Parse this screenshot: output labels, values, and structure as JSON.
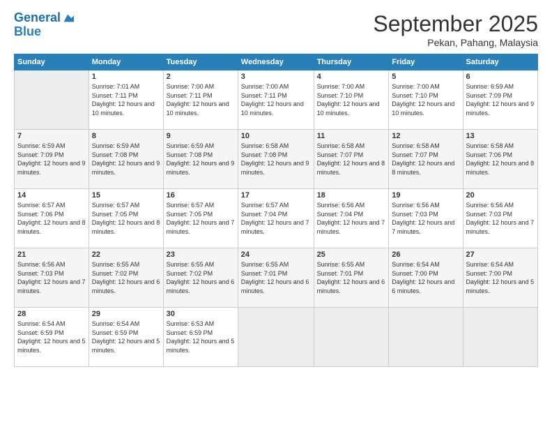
{
  "header": {
    "logo_line1": "General",
    "logo_line2": "Blue",
    "month_title": "September 2025",
    "subtitle": "Pekan, Pahang, Malaysia"
  },
  "columns": [
    "Sunday",
    "Monday",
    "Tuesday",
    "Wednesday",
    "Thursday",
    "Friday",
    "Saturday"
  ],
  "weeks": [
    [
      {
        "day": "",
        "sunrise": "",
        "sunset": "",
        "daylight": ""
      },
      {
        "day": "1",
        "sunrise": "Sunrise: 7:01 AM",
        "sunset": "Sunset: 7:11 PM",
        "daylight": "Daylight: 12 hours and 10 minutes."
      },
      {
        "day": "2",
        "sunrise": "Sunrise: 7:00 AM",
        "sunset": "Sunset: 7:11 PM",
        "daylight": "Daylight: 12 hours and 10 minutes."
      },
      {
        "day": "3",
        "sunrise": "Sunrise: 7:00 AM",
        "sunset": "Sunset: 7:11 PM",
        "daylight": "Daylight: 12 hours and 10 minutes."
      },
      {
        "day": "4",
        "sunrise": "Sunrise: 7:00 AM",
        "sunset": "Sunset: 7:10 PM",
        "daylight": "Daylight: 12 hours and 10 minutes."
      },
      {
        "day": "5",
        "sunrise": "Sunrise: 7:00 AM",
        "sunset": "Sunset: 7:10 PM",
        "daylight": "Daylight: 12 hours and 10 minutes."
      },
      {
        "day": "6",
        "sunrise": "Sunrise: 6:59 AM",
        "sunset": "Sunset: 7:09 PM",
        "daylight": "Daylight: 12 hours and 9 minutes."
      }
    ],
    [
      {
        "day": "7",
        "sunrise": "Sunrise: 6:59 AM",
        "sunset": "Sunset: 7:09 PM",
        "daylight": "Daylight: 12 hours and 9 minutes."
      },
      {
        "day": "8",
        "sunrise": "Sunrise: 6:59 AM",
        "sunset": "Sunset: 7:08 PM",
        "daylight": "Daylight: 12 hours and 9 minutes."
      },
      {
        "day": "9",
        "sunrise": "Sunrise: 6:59 AM",
        "sunset": "Sunset: 7:08 PM",
        "daylight": "Daylight: 12 hours and 9 minutes."
      },
      {
        "day": "10",
        "sunrise": "Sunrise: 6:58 AM",
        "sunset": "Sunset: 7:08 PM",
        "daylight": "Daylight: 12 hours and 9 minutes."
      },
      {
        "day": "11",
        "sunrise": "Sunrise: 6:58 AM",
        "sunset": "Sunset: 7:07 PM",
        "daylight": "Daylight: 12 hours and 8 minutes."
      },
      {
        "day": "12",
        "sunrise": "Sunrise: 6:58 AM",
        "sunset": "Sunset: 7:07 PM",
        "daylight": "Daylight: 12 hours and 8 minutes."
      },
      {
        "day": "13",
        "sunrise": "Sunrise: 6:58 AM",
        "sunset": "Sunset: 7:06 PM",
        "daylight": "Daylight: 12 hours and 8 minutes."
      }
    ],
    [
      {
        "day": "14",
        "sunrise": "Sunrise: 6:57 AM",
        "sunset": "Sunset: 7:06 PM",
        "daylight": "Daylight: 12 hours and 8 minutes."
      },
      {
        "day": "15",
        "sunrise": "Sunrise: 6:57 AM",
        "sunset": "Sunset: 7:05 PM",
        "daylight": "Daylight: 12 hours and 8 minutes."
      },
      {
        "day": "16",
        "sunrise": "Sunrise: 6:57 AM",
        "sunset": "Sunset: 7:05 PM",
        "daylight": "Daylight: 12 hours and 7 minutes."
      },
      {
        "day": "17",
        "sunrise": "Sunrise: 6:57 AM",
        "sunset": "Sunset: 7:04 PM",
        "daylight": "Daylight: 12 hours and 7 minutes."
      },
      {
        "day": "18",
        "sunrise": "Sunrise: 6:56 AM",
        "sunset": "Sunset: 7:04 PM",
        "daylight": "Daylight: 12 hours and 7 minutes."
      },
      {
        "day": "19",
        "sunrise": "Sunrise: 6:56 AM",
        "sunset": "Sunset: 7:03 PM",
        "daylight": "Daylight: 12 hours and 7 minutes."
      },
      {
        "day": "20",
        "sunrise": "Sunrise: 6:56 AM",
        "sunset": "Sunset: 7:03 PM",
        "daylight": "Daylight: 12 hours and 7 minutes."
      }
    ],
    [
      {
        "day": "21",
        "sunrise": "Sunrise: 6:56 AM",
        "sunset": "Sunset: 7:03 PM",
        "daylight": "Daylight: 12 hours and 7 minutes."
      },
      {
        "day": "22",
        "sunrise": "Sunrise: 6:55 AM",
        "sunset": "Sunset: 7:02 PM",
        "daylight": "Daylight: 12 hours and 6 minutes."
      },
      {
        "day": "23",
        "sunrise": "Sunrise: 6:55 AM",
        "sunset": "Sunset: 7:02 PM",
        "daylight": "Daylight: 12 hours and 6 minutes."
      },
      {
        "day": "24",
        "sunrise": "Sunrise: 6:55 AM",
        "sunset": "Sunset: 7:01 PM",
        "daylight": "Daylight: 12 hours and 6 minutes."
      },
      {
        "day": "25",
        "sunrise": "Sunrise: 6:55 AM",
        "sunset": "Sunset: 7:01 PM",
        "daylight": "Daylight: 12 hours and 6 minutes."
      },
      {
        "day": "26",
        "sunrise": "Sunrise: 6:54 AM",
        "sunset": "Sunset: 7:00 PM",
        "daylight": "Daylight: 12 hours and 6 minutes."
      },
      {
        "day": "27",
        "sunrise": "Sunrise: 6:54 AM",
        "sunset": "Sunset: 7:00 PM",
        "daylight": "Daylight: 12 hours and 5 minutes."
      }
    ],
    [
      {
        "day": "28",
        "sunrise": "Sunrise: 6:54 AM",
        "sunset": "Sunset: 6:59 PM",
        "daylight": "Daylight: 12 hours and 5 minutes."
      },
      {
        "day": "29",
        "sunrise": "Sunrise: 6:54 AM",
        "sunset": "Sunset: 6:59 PM",
        "daylight": "Daylight: 12 hours and 5 minutes."
      },
      {
        "day": "30",
        "sunrise": "Sunrise: 6:53 AM",
        "sunset": "Sunset: 6:59 PM",
        "daylight": "Daylight: 12 hours and 5 minutes."
      },
      {
        "day": "",
        "sunrise": "",
        "sunset": "",
        "daylight": ""
      },
      {
        "day": "",
        "sunrise": "",
        "sunset": "",
        "daylight": ""
      },
      {
        "day": "",
        "sunrise": "",
        "sunset": "",
        "daylight": ""
      },
      {
        "day": "",
        "sunrise": "",
        "sunset": "",
        "daylight": ""
      }
    ]
  ]
}
